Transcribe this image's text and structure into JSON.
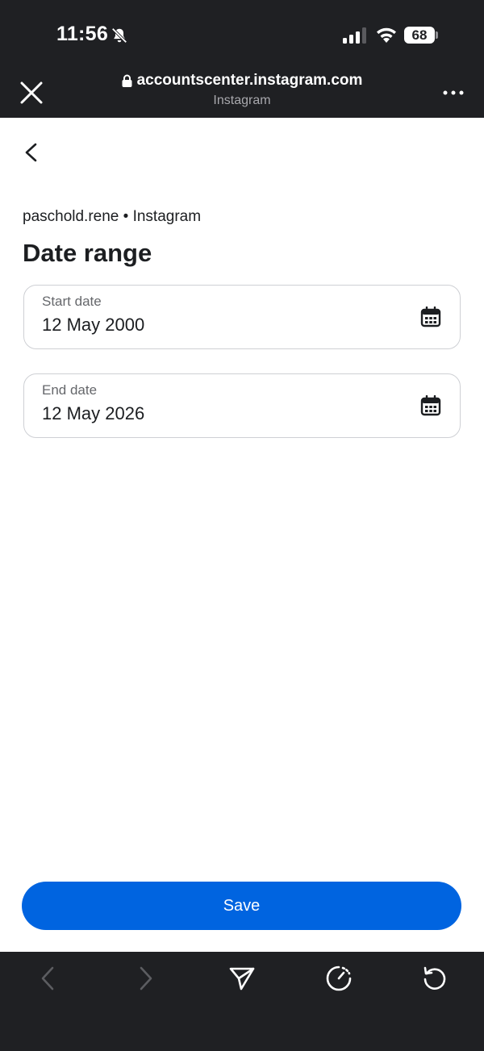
{
  "status_bar": {
    "time": "11:56",
    "battery": "68",
    "icons": [
      "bell-muted-icon",
      "signal-icon",
      "wifi-icon",
      "battery-icon"
    ]
  },
  "browser": {
    "url": "accountscenter.instagram.com",
    "subtitle": "Instagram",
    "icons": [
      "close-icon",
      "lock-icon",
      "more-icon"
    ]
  },
  "page": {
    "account": "paschold.rene • Instagram",
    "title": "Date range",
    "start_date": {
      "label": "Start date",
      "value": "12 May 2000",
      "icon": "calendar-icon"
    },
    "end_date": {
      "label": "End date",
      "value": "12 May 2026",
      "icon": "calendar-icon"
    },
    "save_label": "Save"
  },
  "colors": {
    "accent": "#0064e0",
    "chrome": "#1f2023",
    "border": "#ced0d4",
    "muted_text": "#65676b"
  },
  "toolbar": {
    "icons": [
      "chevron-left-icon",
      "chevron-right-icon",
      "share-icon",
      "speedometer-icon",
      "reload-icon"
    ]
  }
}
